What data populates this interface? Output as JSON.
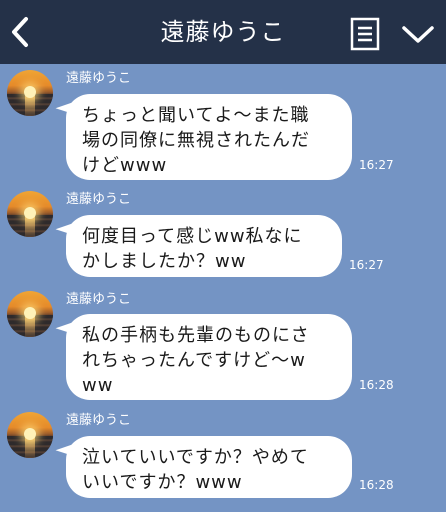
{
  "header": {
    "title": "遠藤ゆうこ",
    "back_icon": "chevron-left-icon",
    "memo_icon": "memo-list-icon",
    "menu_icon": "chevron-down-icon"
  },
  "messages": [
    {
      "sender": "遠藤ゆうこ",
      "lines": [
        "ちょっと聞いてよ〜また職",
        "場の同僚に無視されたんだ",
        "けどwww"
      ],
      "time": "16:27"
    },
    {
      "sender": "遠藤ゆうこ",
      "lines": [
        "何度目って感じww私なに",
        "かしましたか？ww"
      ],
      "time": "16:27"
    },
    {
      "sender": "遠藤ゆうこ",
      "lines": [
        "私の手柄も先輩のものにさ",
        "れちゃったんですけど〜w",
        "ww"
      ],
      "time": "16:28"
    },
    {
      "sender": "遠藤ゆうこ",
      "lines": [
        "泣いていいですか？やめて",
        "いいですか？www"
      ],
      "time": "16:28"
    }
  ],
  "colors": {
    "background": "#7494c4",
    "header": "#243148",
    "bubble": "#ffffff"
  }
}
